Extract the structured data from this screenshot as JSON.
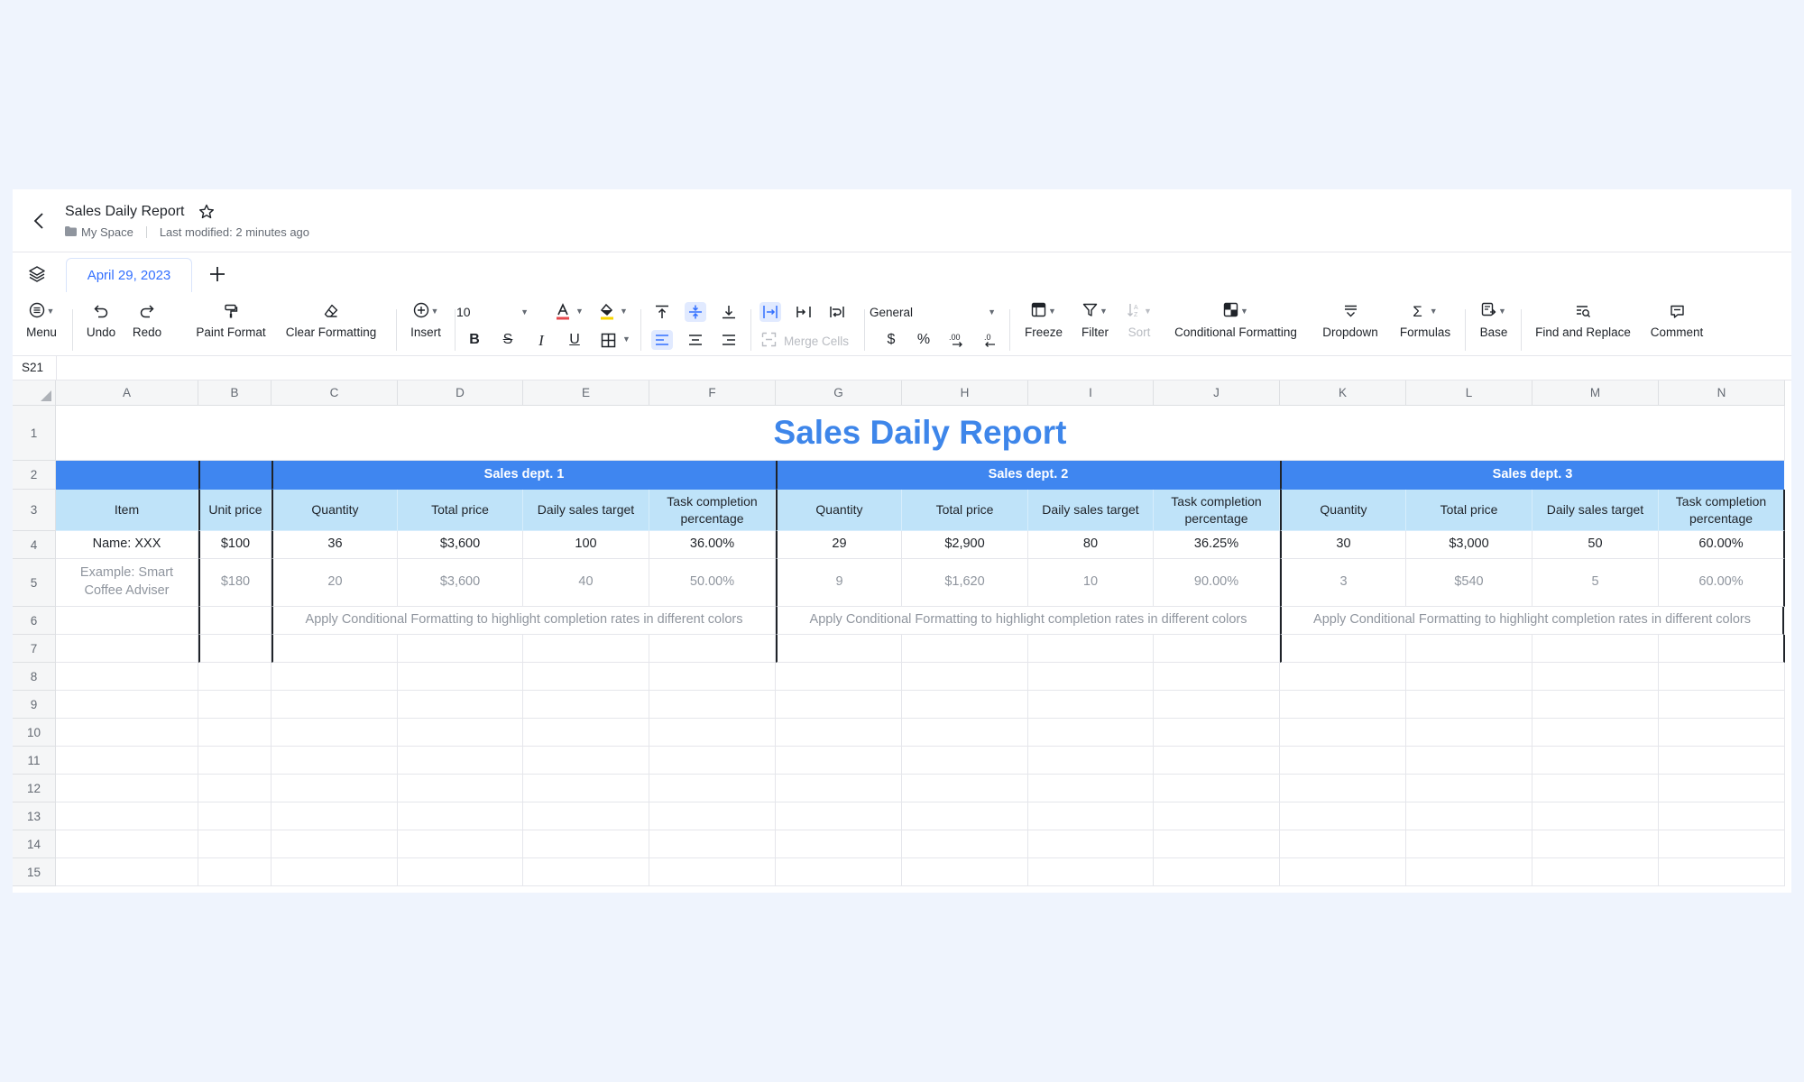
{
  "header": {
    "title": "Sales Daily Report",
    "location": "My Space",
    "last_modified": "Last modified: 2 minutes ago"
  },
  "tabs": [
    {
      "label": "April 29, 2023",
      "active": true
    }
  ],
  "toolbar": {
    "menu": "Menu",
    "undo": "Undo",
    "redo": "Redo",
    "paint_format": "Paint Format",
    "clear_formatting": "Clear Formatting",
    "insert": "Insert",
    "font_size": "10",
    "merge_cells": "Merge Cells",
    "number_format": "General",
    "currency_symbol": "$",
    "percent_symbol": "%",
    "freeze": "Freeze",
    "filter": "Filter",
    "sort": "Sort",
    "conditional_formatting": "Conditional Formatting",
    "dropdown": "Dropdown",
    "formulas": "Formulas",
    "base": "Base",
    "find_replace": "Find and Replace",
    "comment": "Comment",
    "text_color": "#e5484d",
    "fill_color": "#f7d600"
  },
  "formula_bar": {
    "cell_ref": "S21"
  },
  "grid": {
    "columns": [
      "A",
      "B",
      "C",
      "D",
      "E",
      "F",
      "G",
      "H",
      "I",
      "J",
      "K",
      "L",
      "M",
      "N"
    ],
    "row_numbers": [
      "1",
      "2",
      "3",
      "4",
      "5",
      "6",
      "7",
      "8",
      "9",
      "10",
      "11",
      "12",
      "13",
      "14",
      "15"
    ],
    "report_title": "Sales Daily Report",
    "departments": [
      "Sales dept. 1",
      "Sales dept. 2",
      "Sales dept. 3"
    ],
    "item_header": "Item",
    "unit_price_header": "Unit price",
    "dept_headers": [
      "Quantity",
      "Total price",
      "Daily sales target",
      "Task completion percentage"
    ],
    "rows": [
      {
        "item": "Name: XXX",
        "unit_price": "$100",
        "values": [
          "36",
          "$3,600",
          "100",
          "36.00%",
          "29",
          "$2,900",
          "80",
          "36.25%",
          "30",
          "$3,000",
          "50",
          "60.00%"
        ]
      },
      {
        "item": "Example: Smart Coffee Adviser",
        "unit_price": "$180",
        "values": [
          "20",
          "$3,600",
          "40",
          "50.00%",
          "9",
          "$1,620",
          "10",
          "90.00%",
          "3",
          "$540",
          "5",
          "60.00%"
        ]
      }
    ],
    "note": "Apply Conditional Formatting to highlight completion rates in different colors",
    "colors": {
      "title": "#3e86ea",
      "band": "#3f86f0",
      "subheader": "#bfe3f9"
    }
  }
}
